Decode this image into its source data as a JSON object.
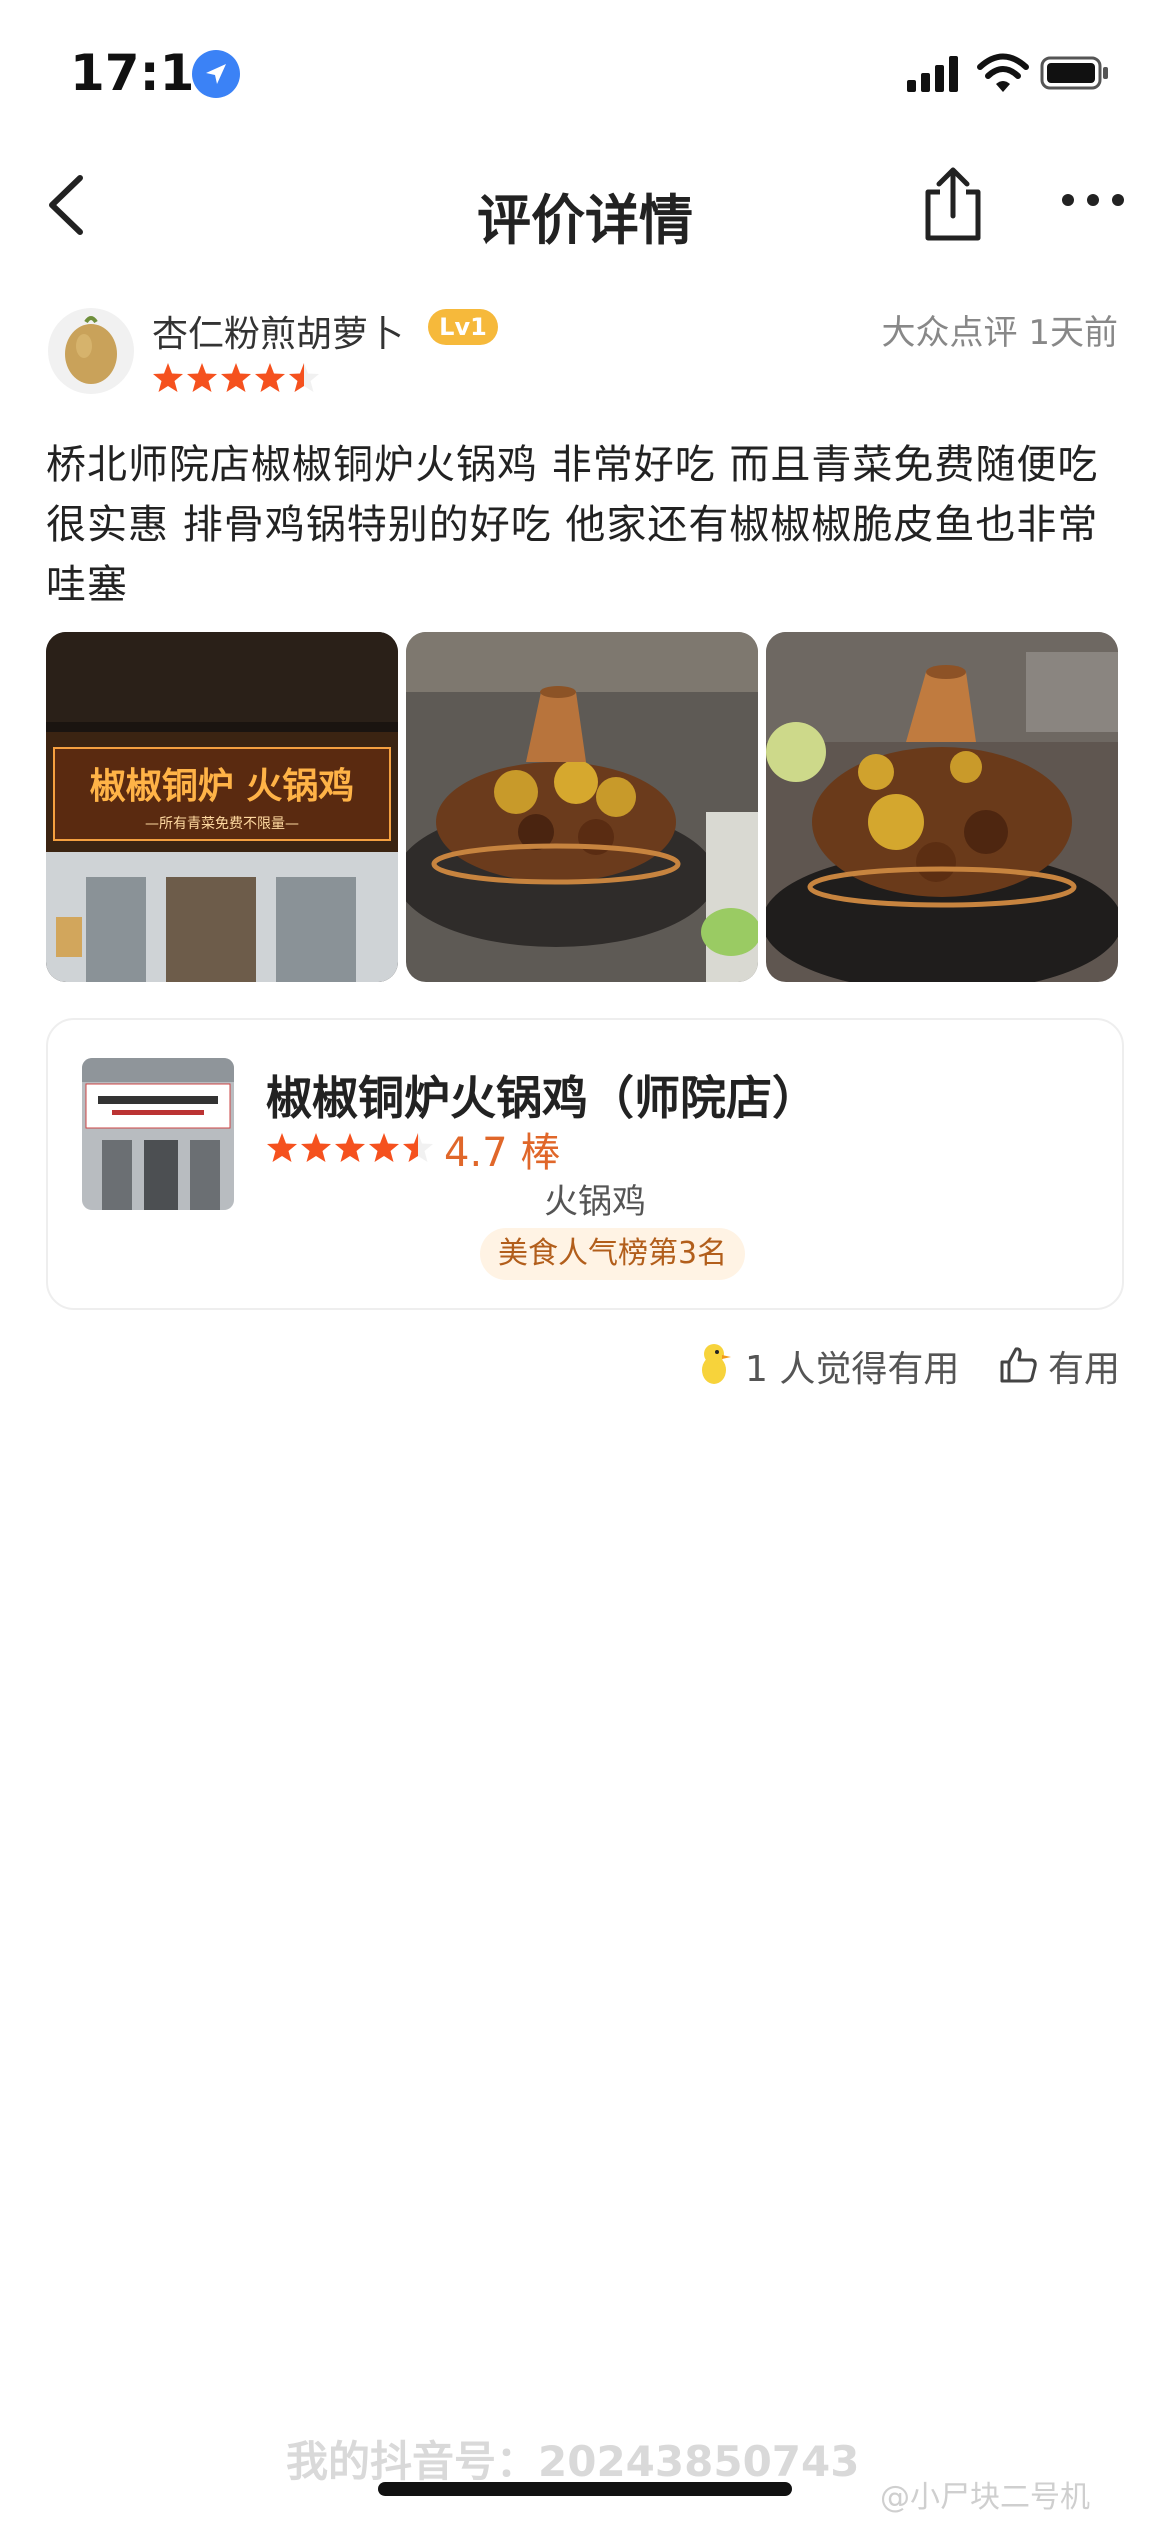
{
  "status_bar": {
    "time": "17:10"
  },
  "nav": {
    "title": "评价详情"
  },
  "review": {
    "username": "杏仁粉煎胡萝卜",
    "level": "Lv1",
    "rating": 4.5,
    "source": "大众点评  1天前",
    "text": "桥北师院店椒椒铜炉火锅鸡  非常好吃  而且青菜免费随便吃  很实惠  排骨鸡锅特别的好吃  他家还有椒椒椒脆皮鱼也非常哇塞",
    "photos": [
      {
        "sign_text": "椒椒铜炉 火锅鸡",
        "sign_sub": "—所有青菜免费不限量—"
      },
      {
        "name": "hotpot-photo-1"
      },
      {
        "name": "hotpot-photo-2"
      }
    ]
  },
  "shop": {
    "name": "椒椒铜炉火锅鸡（师院店）",
    "rating": 4.5,
    "score": "4.7 棒",
    "category": "火锅鸡",
    "rank": "美食人气榜第3名"
  },
  "useful": {
    "count_text": "1 人觉得有用",
    "button_label": "有用"
  },
  "watermarks": {
    "left": "我的抖音号：20243850743",
    "right": "@小尸块二号机"
  },
  "colors": {
    "star": "#f5511e",
    "score": "#e0672a",
    "level_badge": "#f6b93b",
    "rank_bg": "#fff3e4",
    "location": "#3b82f6"
  }
}
